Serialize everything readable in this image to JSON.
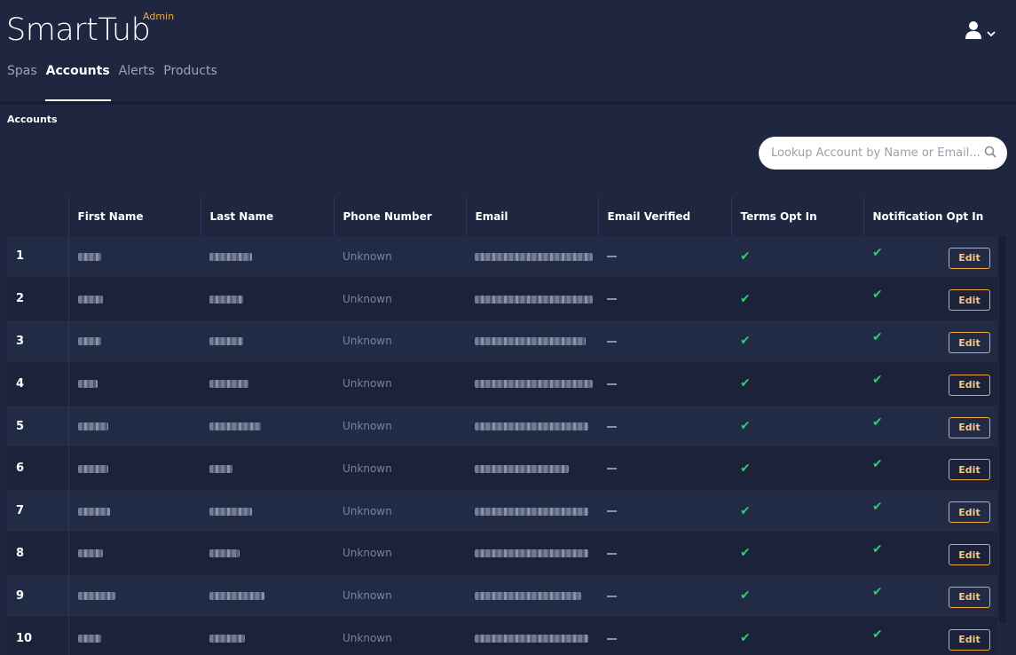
{
  "app": {
    "title": "SmartTub",
    "badge": "Admin"
  },
  "nav": [
    {
      "label": "Spas",
      "active": false
    },
    {
      "label": "Accounts",
      "active": true
    },
    {
      "label": "Alerts",
      "active": false
    },
    {
      "label": "Products",
      "active": false
    }
  ],
  "page": {
    "section_title": "Accounts"
  },
  "search": {
    "placeholder": "Lookup Account by Name or Email..."
  },
  "table": {
    "headers": [
      "",
      "First Name",
      "Last Name",
      "Phone Number",
      "Email",
      "Email Verified",
      "Terms Opt In",
      "Notification Opt In"
    ],
    "edit_label": "Edit",
    "rows": [
      {
        "index": "1",
        "phone": "Unknown"
      },
      {
        "index": "2",
        "phone": "Unknown"
      },
      {
        "index": "3",
        "phone": "Unknown"
      },
      {
        "index": "4",
        "phone": "Unknown"
      },
      {
        "index": "5",
        "phone": "Unknown"
      },
      {
        "index": "6",
        "phone": "Unknown"
      },
      {
        "index": "7",
        "phone": "Unknown"
      },
      {
        "index": "8",
        "phone": "Unknown"
      },
      {
        "index": "9",
        "phone": "Unknown"
      },
      {
        "index": "10",
        "phone": "Unknown"
      }
    ]
  },
  "icons": {
    "user": "user-icon",
    "chevron": "chevron-down-icon",
    "search": "search-icon",
    "check": "check-icon"
  },
  "colors": {
    "accent": "#f2a93b",
    "check": "#2ecc71",
    "background": "#1e2640"
  }
}
